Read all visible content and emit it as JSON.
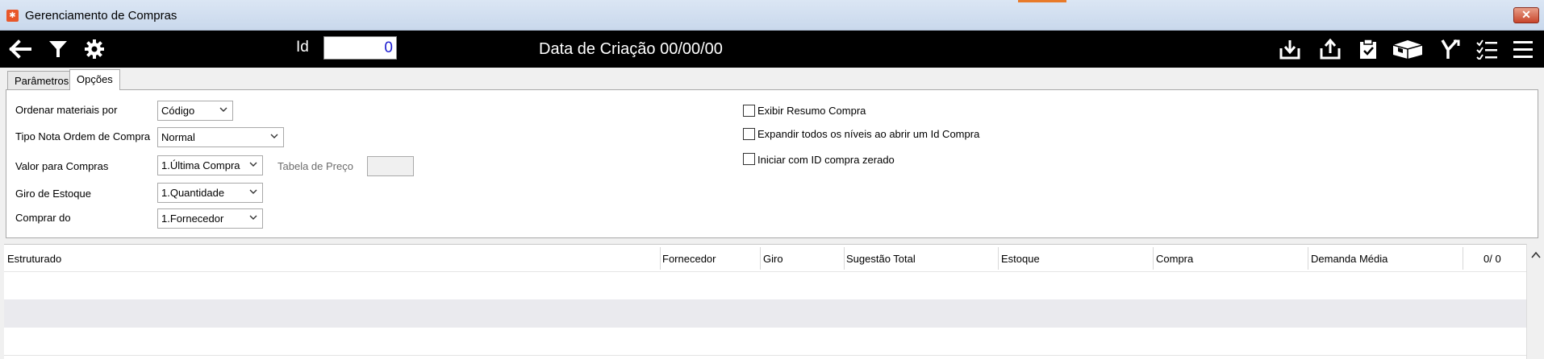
{
  "window": {
    "title": "Gerenciamento de Compras",
    "close_label": "✕"
  },
  "toolbar": {
    "id_label": "Id",
    "id_value": "0",
    "date_label": "Data de Criação 00/00/00"
  },
  "tabs": [
    {
      "label": "Parâmetros"
    },
    {
      "label": "Opções"
    }
  ],
  "form": {
    "ordenar_label": "Ordenar materiais por",
    "ordenar_value": "Código",
    "tipo_nota_label": "Tipo Nota Ordem de Compra",
    "tipo_nota_value": "Normal",
    "valor_label": "Valor para Compras",
    "valor_value": "1.Última Compra",
    "tabela_label": "Tabela de Preço",
    "giro_label": "Giro de Estoque",
    "giro_value": "1.Quantidade",
    "comprar_label": "Comprar do",
    "comprar_value": "1.Fornecedor"
  },
  "checkboxes": [
    {
      "label": "Exibir Resumo Compra",
      "checked": false
    },
    {
      "label": "Expandir todos os níveis ao abrir um Id Compra",
      "checked": false
    },
    {
      "label": "Iniciar com ID compra zerado",
      "checked": false
    }
  ],
  "grid": {
    "columns": [
      "Estruturado",
      "Fornecedor",
      "Giro",
      "Sugestão Total",
      "Estoque",
      "Compra",
      "Demanda Média"
    ],
    "counter": "0/ 0",
    "rows": []
  },
  "colors": {
    "toolbar_bg": "#000000",
    "id_value_color": "#1a1ad0",
    "app_icon": "#e8572a"
  },
  "icons": {
    "toolbar_left": [
      "back-arrow-icon",
      "filter-icon",
      "gear-icon"
    ],
    "toolbar_right": [
      "import-icon",
      "export-icon",
      "clipboard-icon",
      "package-icon",
      "fork-icon",
      "checklist-icon",
      "menu-icon"
    ]
  }
}
